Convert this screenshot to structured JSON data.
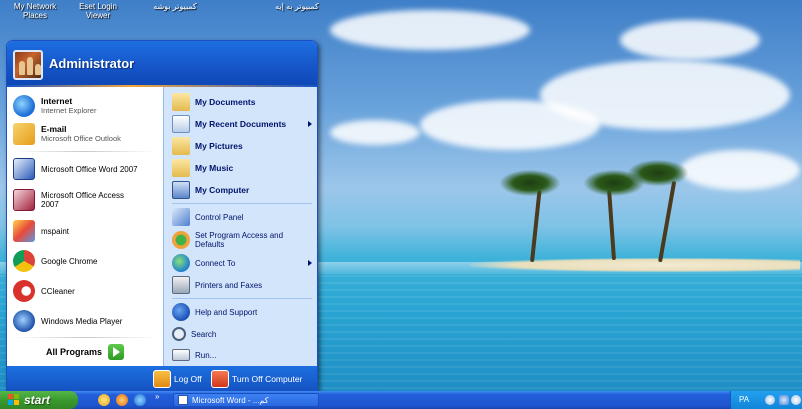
{
  "desktop": {
    "icons": [
      {
        "label_line1": "My Network",
        "label_line2": "Places"
      },
      {
        "label_line1": "Eset Login",
        "label_line2": "Viewer"
      },
      {
        "label_line1": "كمبيوتر بوشه",
        "label_line2": ""
      },
      {
        "label_line1": "كمبيوتر به إيه",
        "label_line2": ""
      }
    ]
  },
  "start_menu": {
    "username": "Administrator",
    "pinned": [
      {
        "title": "Internet",
        "subtitle": "Internet Explorer",
        "icon": "internet-explorer-icon"
      },
      {
        "title": "E-mail",
        "subtitle": "Microsoft Office Outlook",
        "icon": "outlook-icon"
      }
    ],
    "recent": [
      {
        "label": "Microsoft Office Word 2007",
        "icon": "word-icon"
      },
      {
        "label": "Microsoft Office Access 2007",
        "icon": "access-icon"
      },
      {
        "label": "mspaint",
        "icon": "paint-icon"
      },
      {
        "label": "Google Chrome",
        "icon": "chrome-icon"
      },
      {
        "label": "CCleaner",
        "icon": "ccleaner-icon"
      },
      {
        "label": "Windows Media Player",
        "icon": "media-player-icon"
      }
    ],
    "all_programs": "All Programs",
    "places": [
      {
        "label": "My Documents",
        "icon": "folder-icon"
      },
      {
        "label": "My Recent Documents",
        "icon": "recent-documents-icon"
      },
      {
        "label": "My Pictures",
        "icon": "pictures-folder-icon"
      },
      {
        "label": "My Music",
        "icon": "music-folder-icon"
      },
      {
        "label": "My Computer",
        "icon": "computer-icon"
      }
    ],
    "system": [
      {
        "label": "Control Panel",
        "icon": "control-panel-icon"
      },
      {
        "label": "Set Program Access and Defaults",
        "icon": "program-defaults-icon"
      },
      {
        "label": "Connect To",
        "icon": "connect-icon"
      },
      {
        "label": "Printers and Faxes",
        "icon": "printer-icon"
      }
    ],
    "help": [
      {
        "label": "Help and Support",
        "icon": "help-icon"
      },
      {
        "label": "Search",
        "icon": "search-icon"
      },
      {
        "label": "Run...",
        "icon": "run-icon"
      }
    ],
    "footer": {
      "log_off": "Log Off",
      "turn_off": "Turn Off Computer"
    }
  },
  "taskbar": {
    "start_label": "start",
    "more_label": "»",
    "active_task": "Microsoft Word - ...كم",
    "tray_language": "PA"
  },
  "colors": {
    "xp_blue": "#1656c9",
    "start_green": "#3b9a2e",
    "right_pane": "#d3e5fa"
  }
}
